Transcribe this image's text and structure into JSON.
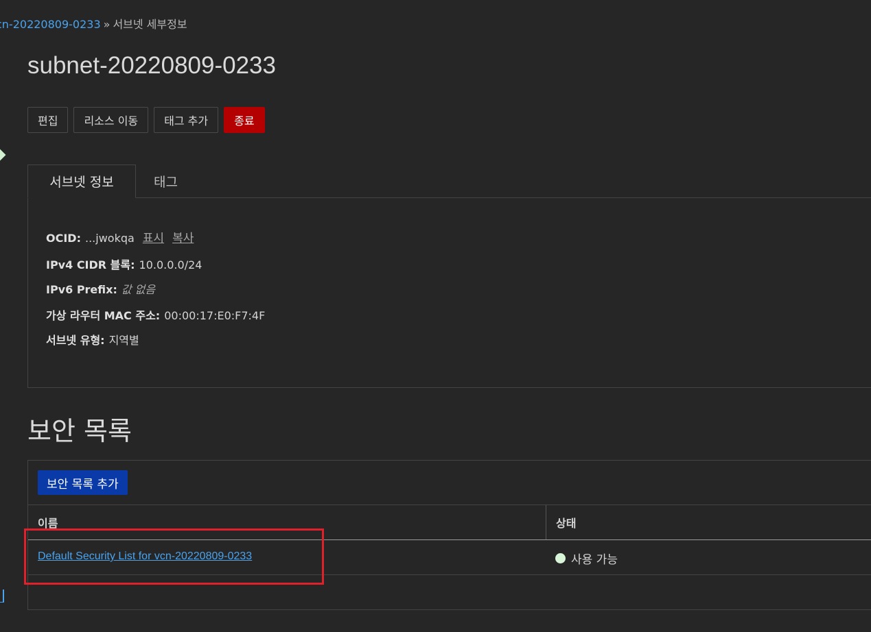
{
  "breadcrumb": {
    "parent": "cn-20220809-0233",
    "separator": "»",
    "current": "서브넷 세부정보"
  },
  "page_title": "subnet-20220809-0233",
  "actions": {
    "edit": "편집",
    "move": "리소스 이동",
    "add_tag": "태그 추가",
    "terminate": "종료"
  },
  "tabs": {
    "info": "서브넷 정보",
    "tags": "태그"
  },
  "info": {
    "ocid_label": "OCID:",
    "ocid_value": "...jwokqa",
    "show_link": "표시",
    "copy_link": "복사",
    "ipv4_label": "IPv4 CIDR 블록:",
    "ipv4_value": "10.0.0.0/24",
    "ipv6_label": "IPv6 Prefix:",
    "ipv6_value": "값 없음",
    "mac_label": "가상 라우터 MAC 주소:",
    "mac_value": "00:00:17:E0:F7:4F",
    "type_label": "서브넷 유형:",
    "type_value": "지역별"
  },
  "security": {
    "title": "보안 목록",
    "add_button": "보안 목록 추가",
    "columns": {
      "name": "이름",
      "status": "상태"
    },
    "rows": [
      {
        "name": "Default Security List for vcn-20220809-0233",
        "status": "사용 가능"
      }
    ]
  },
  "colors": {
    "link": "#4aa3ee",
    "danger": "#b40000",
    "primary": "#0a3aa8",
    "highlight": "#e0202a",
    "status_available": "#d8f5d8"
  }
}
